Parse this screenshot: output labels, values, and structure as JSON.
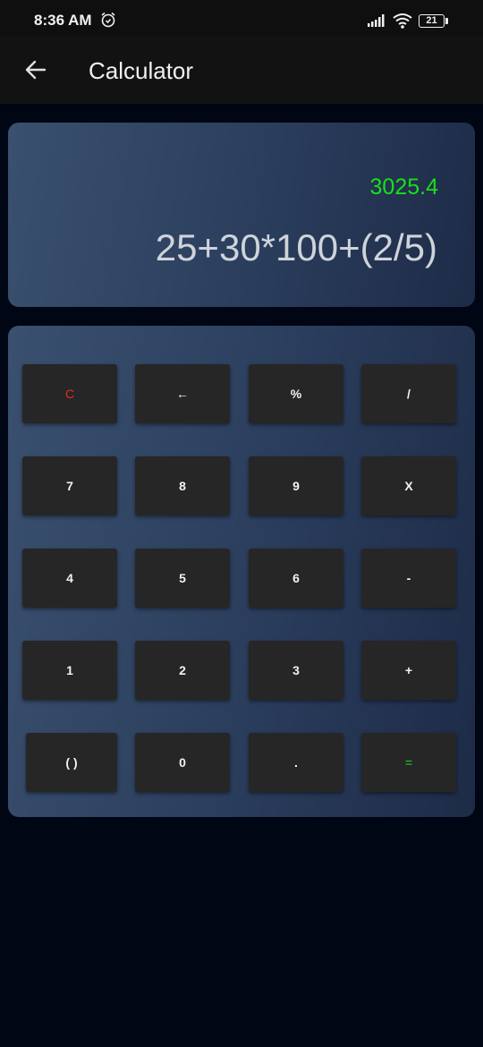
{
  "status_bar": {
    "time": "8:36 AM",
    "alarm_icon": "alarm-clock-icon",
    "signal_icon": "cell-signal-icon",
    "wifi_icon": "wifi-icon",
    "battery_level": "21"
  },
  "app_bar": {
    "back_icon": "arrow-left-icon",
    "title": "Calculator"
  },
  "display": {
    "result": "3025.4",
    "expression": "25+30*100+(2/5)",
    "result_color": "#19e01b"
  },
  "keypad": {
    "rows": [
      [
        "C",
        "←",
        "%",
        "/"
      ],
      [
        "7",
        "8",
        "9",
        "X"
      ],
      [
        "4",
        "5",
        "6",
        "-"
      ],
      [
        "1",
        "2",
        "3",
        "+"
      ],
      [
        "( )",
        "0",
        ".",
        "="
      ]
    ]
  },
  "colors": {
    "background": "#010614",
    "card_gradient_start": "#3a506f",
    "card_gradient_end": "#1d2b47",
    "key": "#262626",
    "clear_key": "#e62a1e",
    "equals_key": "#19e01b"
  }
}
